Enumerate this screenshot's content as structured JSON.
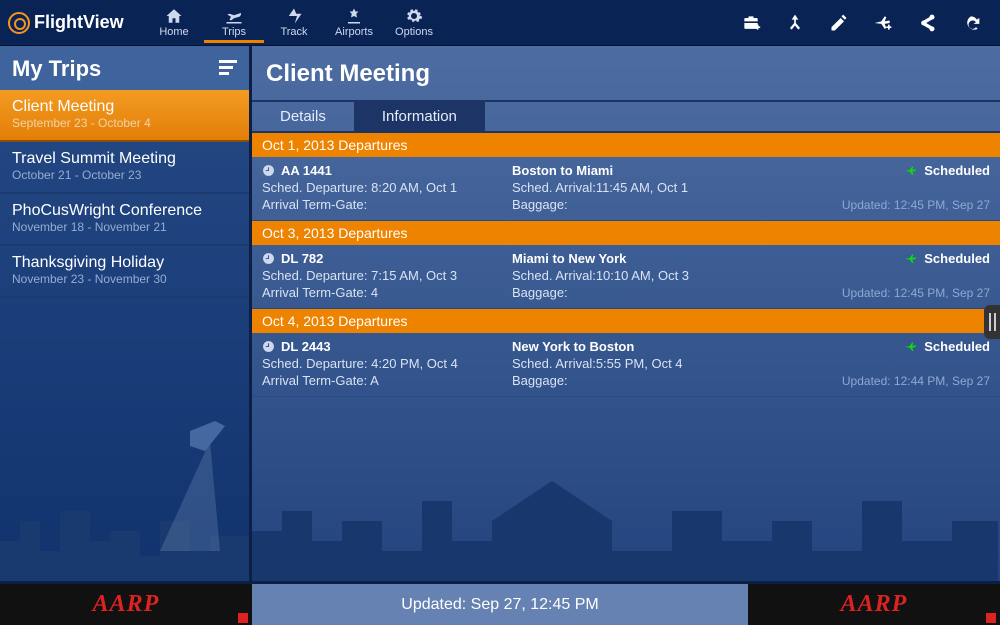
{
  "brand": "FlightView",
  "nav": {
    "items": [
      {
        "label": "Home"
      },
      {
        "label": "Trips"
      },
      {
        "label": "Track"
      },
      {
        "label": "Airports"
      },
      {
        "label": "Options"
      }
    ],
    "active_index": 1
  },
  "sidebar": {
    "title": "My Trips",
    "trips": [
      {
        "name": "Client Meeting",
        "dates": "September 23 - October 4",
        "active": true
      },
      {
        "name": "Travel Summit Meeting",
        "dates": "October 21 - October 23"
      },
      {
        "name": "PhoCusWright Conference",
        "dates": "November 18 - November 21"
      },
      {
        "name": "Thanksgiving Holiday",
        "dates": "November 23 - November 30"
      }
    ]
  },
  "content": {
    "title": "Client Meeting",
    "tabs": {
      "details": "Details",
      "information": "Information",
      "active": "information"
    },
    "groups": [
      {
        "header": "Oct 1, 2013 Departures",
        "flight": {
          "number": "AA 1441",
          "sched_dep": "Sched. Departure: 8:20 AM, Oct 1",
          "gate": "Arrival Term-Gate:",
          "route": "Boston to Miami",
          "sched_arr": "Sched. Arrival:11:45 AM, Oct 1",
          "baggage": "Baggage:",
          "status": "Scheduled",
          "updated": "Updated:  12:45 PM, Sep 27"
        }
      },
      {
        "header": "Oct 3, 2013 Departures",
        "flight": {
          "number": "DL 782",
          "sched_dep": "Sched. Departure: 7:15 AM, Oct 3",
          "gate": "Arrival Term-Gate: 4",
          "route": "Miami to New York",
          "sched_arr": "Sched. Arrival:10:10 AM, Oct 3",
          "baggage": "Baggage:",
          "status": "Scheduled",
          "updated": "Updated:  12:45 PM, Sep 27"
        }
      },
      {
        "header": "Oct 4, 2013 Departures",
        "flight": {
          "number": "DL 2443",
          "sched_dep": "Sched. Departure: 4:20 PM, Oct 4",
          "gate": "Arrival Term-Gate: A",
          "route": "New York to Boston",
          "sched_arr": "Sched. Arrival:5:55 PM, Oct 4",
          "baggage": "Baggage:",
          "status": "Scheduled",
          "updated": "Updated:  12:44 PM, Sep 27"
        }
      }
    ]
  },
  "footer": {
    "ad_text": "AARP",
    "updated": "Updated: Sep 27, 12:45 PM"
  }
}
